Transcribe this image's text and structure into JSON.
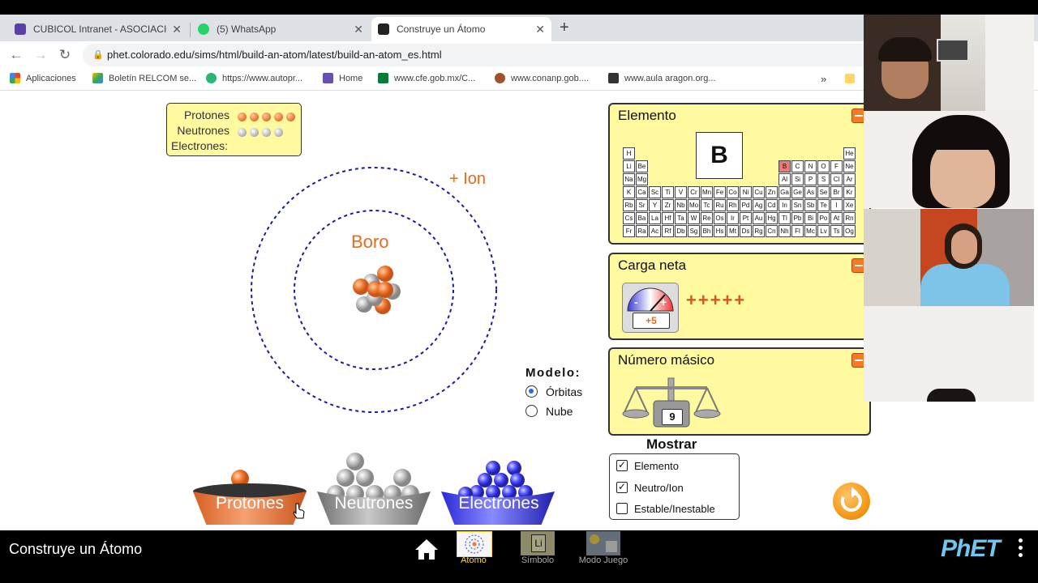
{
  "browser": {
    "tabs": [
      {
        "title": "CUBICOL Intranet - ASOCIACION",
        "close": "✕",
        "favicon": "cubicol-icon"
      },
      {
        "title": "(5) WhatsApp",
        "close": "✕",
        "favicon": "whatsapp-icon"
      },
      {
        "title": "Construye un Átomo",
        "close": "✕",
        "favicon": "phet-icon"
      }
    ],
    "new_tab": "+",
    "url": "phet.colorado.edu/sims/html/build-an-atom/latest/build-an-atom_es.html",
    "bookmarks": [
      "Aplicaciones",
      "Boletín RELCOM se...",
      "https://www.autopr...",
      "Home",
      "www.cfe.gob.mx/C...",
      "www.conanp.gob....",
      "www.aula  aragon.org..."
    ],
    "bookmarks_more": "»"
  },
  "sim": {
    "legend": {
      "protons_label": "Protones",
      "neutrons_label": "Neutrones",
      "electrons_label": "Electrones:",
      "protons": 5,
      "neutrons": 4,
      "electrons": 0
    },
    "ion_label": "+ Ion",
    "element_name": "Boro",
    "model": {
      "title": "Modelo:",
      "options": [
        "Órbitas",
        "Nube"
      ],
      "selected": "Órbitas"
    },
    "buckets": [
      "Protones",
      "Neutrones",
      "Electrones"
    ],
    "element_panel": {
      "title": "Elemento",
      "symbol": "B"
    },
    "charge_panel": {
      "title": "Carga neta",
      "value": "+5",
      "pluses": "+++++"
    },
    "mass_panel": {
      "title": "Número másico",
      "value": "9"
    },
    "show": {
      "title": "Mostrar",
      "options": [
        {
          "label": "Elemento",
          "checked": true
        },
        {
          "label": "Neutro/Ion",
          "checked": true
        },
        {
          "label": "Estable/Inestable",
          "checked": false
        }
      ]
    }
  },
  "navbar": {
    "title": "Construye un Átomo",
    "screens": [
      "Átomo",
      "Símbolo",
      "Modo Juego"
    ],
    "brand": "PhET"
  },
  "colors": {
    "proton": "#f2782e",
    "neutron": "#b8b8b8",
    "electron": "#4a4aff",
    "panel": "#fff9a0",
    "accent": "#f47a24"
  }
}
